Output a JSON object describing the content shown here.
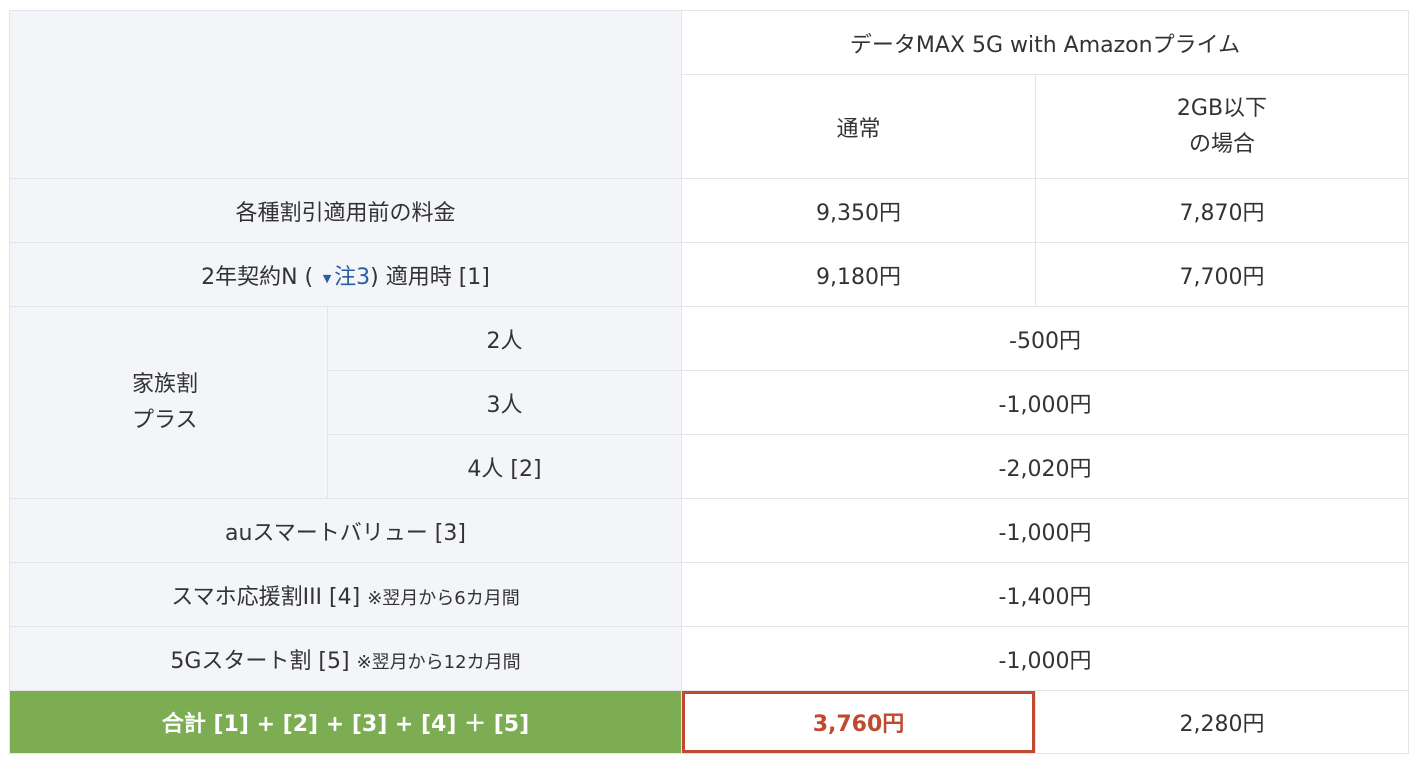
{
  "header": {
    "plan_name": "データMAX 5G with Amazonプライム",
    "col_normal": "通常",
    "col_2gb_line1": "2GB以下",
    "col_2gb_line2": "の場合"
  },
  "rows": {
    "base": {
      "label": "各種割引適用前の料金",
      "normal": "9,350円",
      "under2gb": "7,870円"
    },
    "contract": {
      "label_pre": "2年契約N (",
      "note_icon": "arrow-down-icon",
      "note_link": "注3",
      "label_post": ") 適用時 [1]",
      "normal": "9,180円",
      "under2gb": "7,700円"
    },
    "family": {
      "label_line1": "家族割",
      "label_line2": "プラス",
      "items": [
        {
          "people": "2人",
          "value": "-500円"
        },
        {
          "people": "3人",
          "value": "-1,000円"
        },
        {
          "people": "4人 [2]",
          "value": "-2,020円"
        }
      ]
    },
    "au_smart": {
      "label": "auスマートバリュー [3]",
      "value": "-1,000円"
    },
    "smartphone_support": {
      "label": "スマホ応援割III [4]",
      "note": "※翌月から6カ月間",
      "value": "-1,400円"
    },
    "start_5g": {
      "label": "5Gスタート割 [5]",
      "note": "※翌月から12カ月間",
      "value": "-1,000円"
    },
    "total": {
      "label": "合計 [1] + [2] + [3] + [4] ＋ [5]",
      "normal": "3,760円",
      "under2gb": "2,280円"
    }
  },
  "colors": {
    "highlight_border": "#c0492f",
    "total_label_bg": "#7cad53",
    "label_bg": "#f3f5f8",
    "link": "#2a5ea3"
  }
}
